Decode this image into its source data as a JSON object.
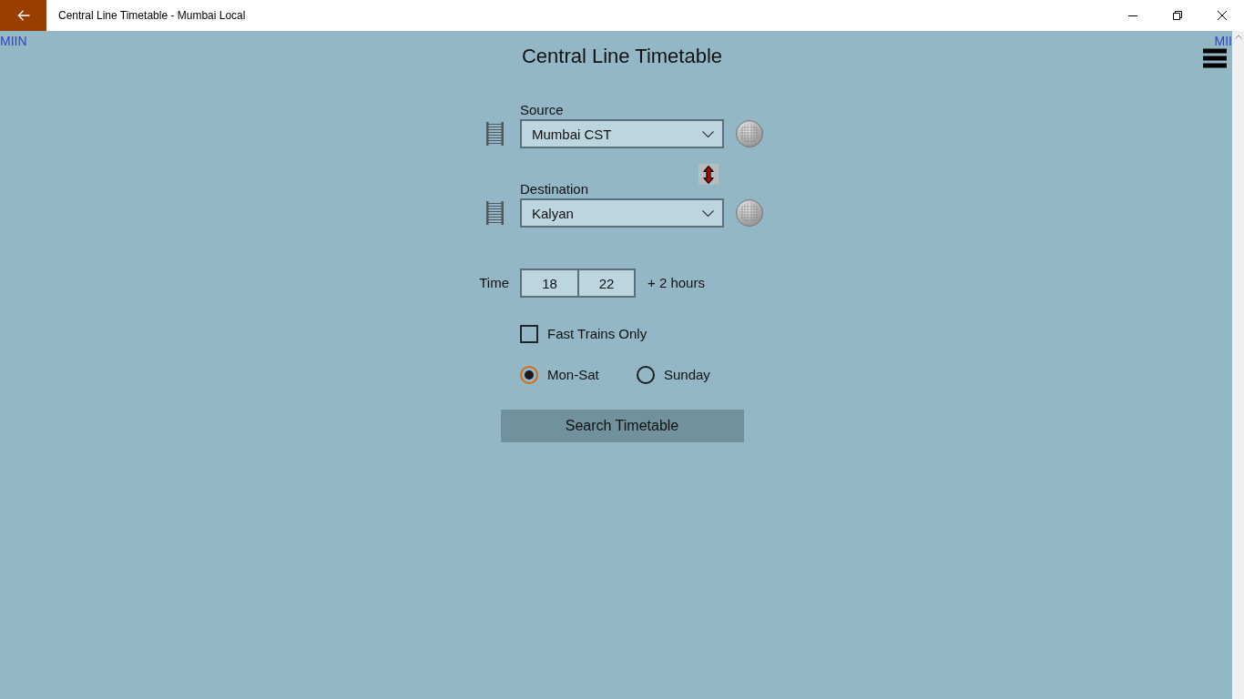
{
  "window": {
    "title": "Central Line Timetable - Mumbai Local"
  },
  "header": {
    "left_text": "MIIN",
    "right_text": "MII",
    "title": "Central Line Timetable"
  },
  "stations": [
    {
      "label": "Source",
      "value": "Mumbai CST"
    },
    {
      "label": "Destination",
      "value": "Kalyan"
    }
  ],
  "time": {
    "label": "Time",
    "hour": "18",
    "minute": "22",
    "range": "+ 2 hours"
  },
  "fast_trains": {
    "label": "Fast Trains Only",
    "checked": false
  },
  "day_options": [
    {
      "label": "Mon-Sat",
      "selected": true
    },
    {
      "label": "Sunday",
      "selected": false
    }
  ],
  "search_button": {
    "label": "Search Timetable"
  }
}
